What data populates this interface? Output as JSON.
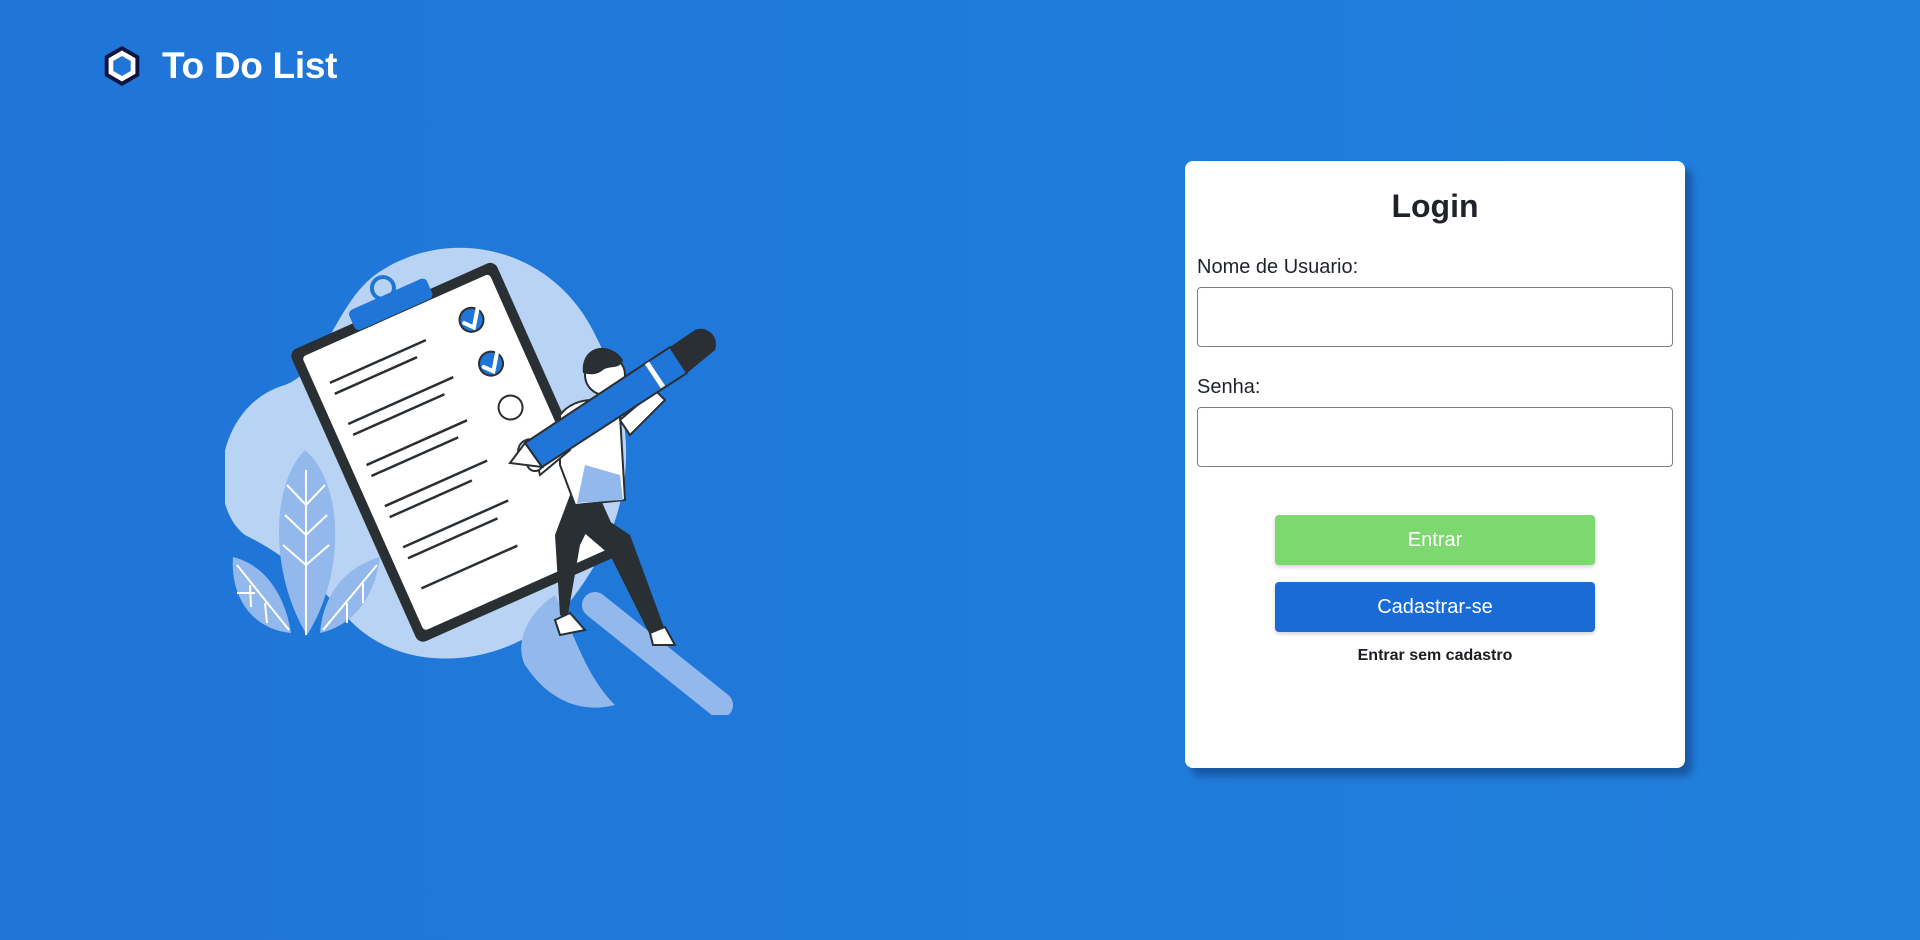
{
  "header": {
    "logo_icon": "hexagon-icon",
    "title": "To Do List"
  },
  "illustration": {
    "icon": "person-with-pencil-checklist-illustration"
  },
  "login_form": {
    "title": "Login",
    "username_label": "Nome de Usuario:",
    "username_value": "",
    "password_label": "Senha:",
    "password_value": "",
    "login_button": "Entrar",
    "register_button": "Cadastrar-se",
    "guest_link": "Entrar sem cadastro"
  },
  "colors": {
    "background": "#1f75d8",
    "card_background": "#ffffff",
    "login_button": "#7ed870",
    "register_button": "#1b6bd6",
    "text_dark": "#1f2329"
  }
}
